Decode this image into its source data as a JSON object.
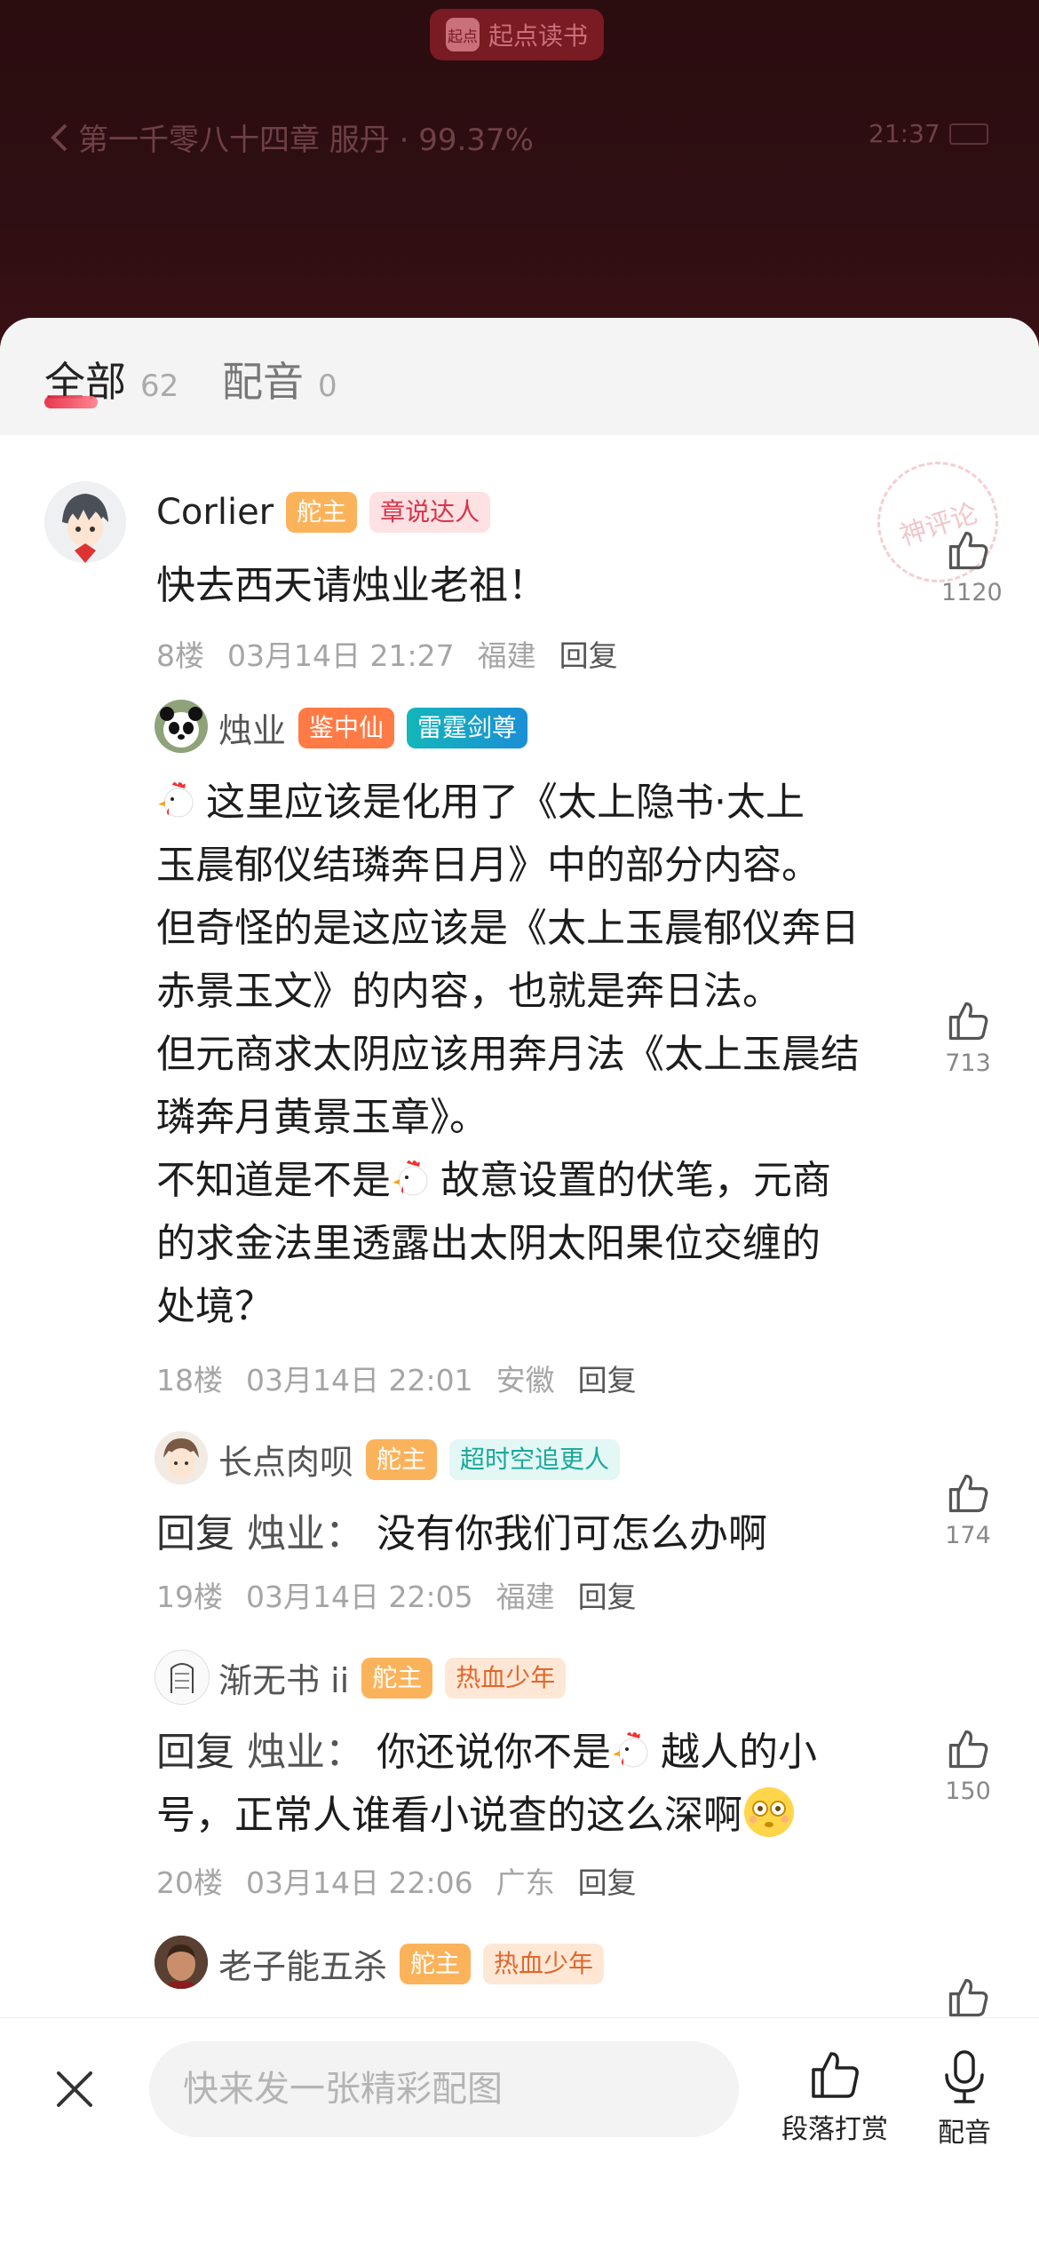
{
  "reader": {
    "brand": "起点读书",
    "brand_logo_text": "起点",
    "chapter_info": "第一千零八十四章 服丹 · 99.37%",
    "time": "21:37"
  },
  "tabs": [
    {
      "label": "全部",
      "count": "62"
    },
    {
      "label": "配音",
      "count": "0"
    }
  ],
  "stamp_text": "神评论",
  "comments": [
    {
      "username": "Corlier",
      "badges": [
        "舵主",
        "章说达人"
      ],
      "text": "快去西天请烛业老祖！",
      "floor": "8楼",
      "date": "03月14日 21:27",
      "location": "福建",
      "reply": "回复",
      "likes": "1120"
    },
    {
      "username": "烛业",
      "badges": [
        "鉴中仙",
        "雷霆剑尊"
      ],
      "text_lines": [
        "这里应该是化用了《太上隐书·太上",
        "玉晨郁仪结璘奔日月》中的部分内容。",
        "但奇怪的是这应该是《太上玉晨郁仪奔日",
        "赤景玉文》的内容，也就是奔日法。",
        "但元商求太阴应该用奔月法《太上玉晨结",
        "璘奔月黄景玉章》。",
        "不知道是不是",
        "故意设置的伏笔，元商",
        "的求金法里透露出太阴太阳果位交缠的",
        "处境？"
      ],
      "floor": "18楼",
      "date": "03月14日 22:01",
      "location": "安徽",
      "reply": "回复",
      "likes": "713"
    },
    {
      "username": "长点肉呗",
      "badges": [
        "舵主",
        "超时空追更人"
      ],
      "reply_prefix": "回复",
      "reply_to": "烛业：",
      "text": "没有你我们可怎么办啊",
      "floor": "19楼",
      "date": "03月14日 22:05",
      "location": "福建",
      "reply": "回复",
      "likes": "174"
    },
    {
      "username": "渐无书 ii",
      "badges": [
        "舵主",
        "热血少年"
      ],
      "reply_prefix": "回复",
      "reply_to": "烛业：",
      "text_a": "你还说你不是",
      "text_b": "越人的小",
      "text_c": "号，正常人谁看小说查的这么深啊",
      "floor": "20楼",
      "date": "03月14日 22:06",
      "location": "广东",
      "reply": "回复",
      "likes": "150"
    },
    {
      "username": "老子能五杀",
      "badges": [
        "舵主",
        "热血少年"
      ]
    }
  ],
  "bottom": {
    "input_placeholder": "快来发一张精彩配图",
    "tip_label": "段落打赏",
    "dub_label": "配音"
  }
}
